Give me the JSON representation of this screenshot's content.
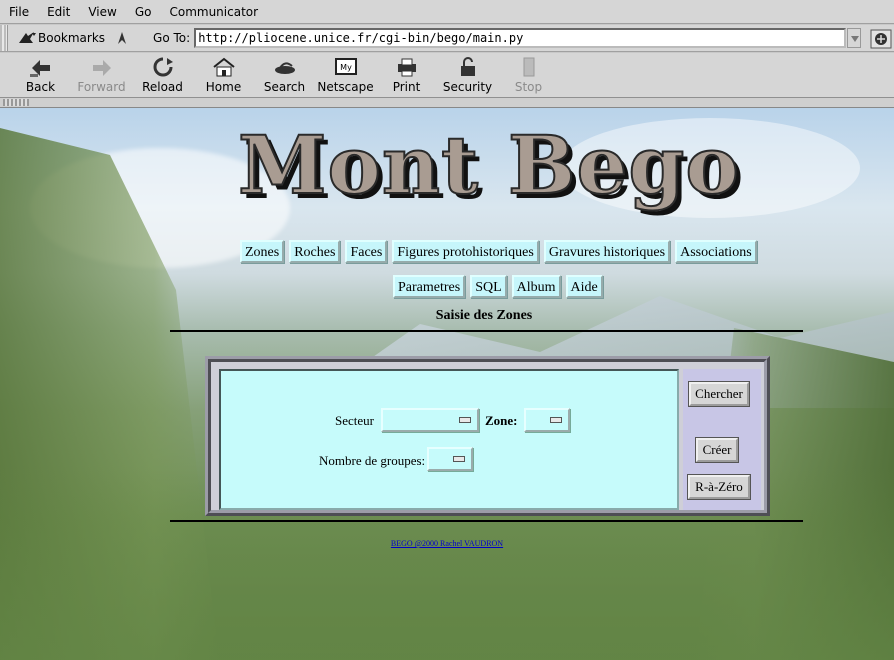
{
  "browser": {
    "menu": [
      "File",
      "Edit",
      "View",
      "Go",
      "Communicator"
    ],
    "bookmarks_label": "Bookmarks",
    "goto_label": "Go To:",
    "url": "http://pliocene.unice.fr/cgi-bin/bego/main.py",
    "toolbar": [
      {
        "label": "Back",
        "icon": "back-icon",
        "enabled": true
      },
      {
        "label": "Forward",
        "icon": "forward-icon",
        "enabled": false
      },
      {
        "label": "Reload",
        "icon": "reload-icon",
        "enabled": true
      },
      {
        "label": "Home",
        "icon": "home-icon",
        "enabled": true
      },
      {
        "label": "Search",
        "icon": "search-icon",
        "enabled": true
      },
      {
        "label": "Netscape",
        "icon": "netscape-icon",
        "enabled": true
      },
      {
        "label": "Print",
        "icon": "print-icon",
        "enabled": true
      },
      {
        "label": "Security",
        "icon": "lock-icon",
        "enabled": true
      },
      {
        "label": "Stop",
        "icon": "stop-icon",
        "enabled": false
      }
    ]
  },
  "page": {
    "title": "Mont Bego",
    "nav_row1": [
      "Zones",
      "Roches",
      "Faces",
      "Figures protohistoriques",
      "Gravures historiques",
      "Associations"
    ],
    "nav_row2": [
      "Parametres",
      "SQL",
      "Album",
      "Aide"
    ],
    "section_title": "Saisie des Zones",
    "form": {
      "secteur_label": "Secteur",
      "zone_label": "Zone:",
      "groupes_label": "Nombre de groupes:",
      "secteur_value": "",
      "zone_value": "",
      "groupes_value": ""
    },
    "buttons": {
      "search": "Chercher",
      "create": "Créer",
      "reset": "R-à-Zéro"
    },
    "footer": "BEGO @2000 Rachel VAUDRON"
  },
  "colors": {
    "nav_bg": "#c6f6fb",
    "panel_bg": "#c6fbfb",
    "side_bg": "#c8c6e6",
    "title_fill": "#a99c92"
  }
}
